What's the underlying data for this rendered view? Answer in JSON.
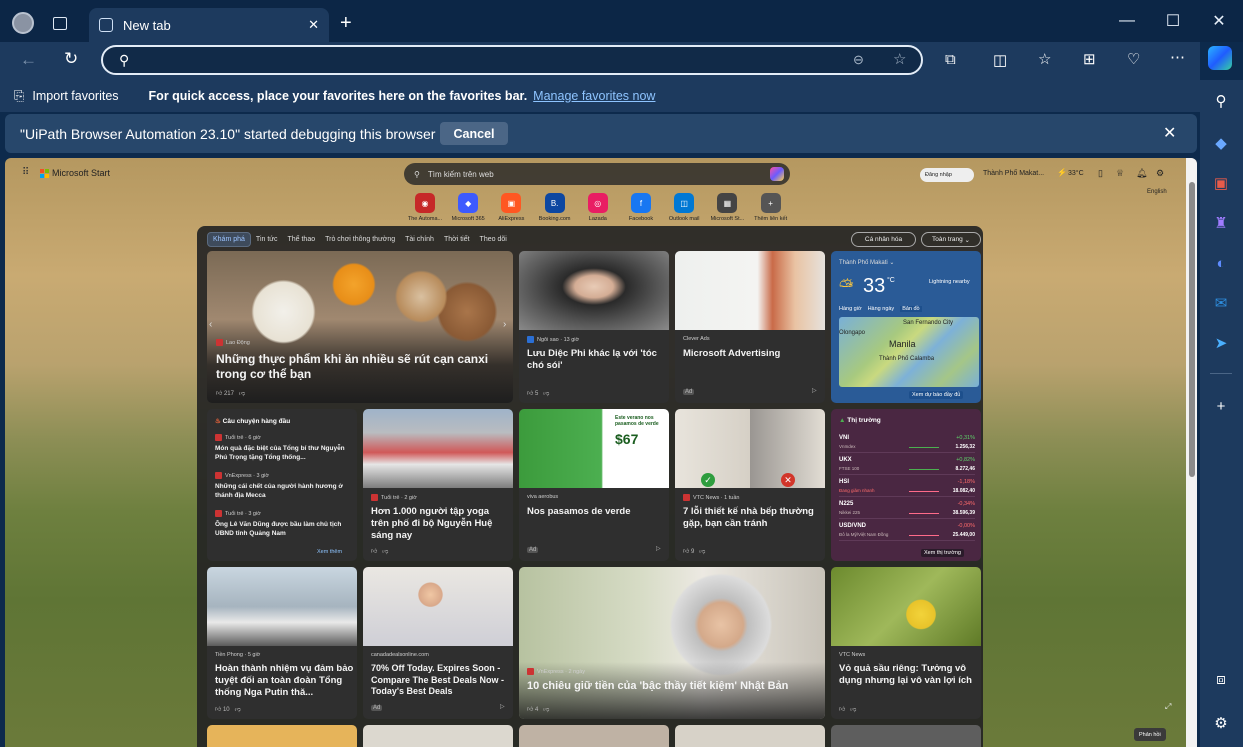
{
  "browser": {
    "tab_title": "New tab",
    "address_value": ""
  },
  "favorites": {
    "import_label": "Import favorites",
    "prompt": "For quick access, place your favorites here on the favorites bar.",
    "manage_link": "Manage favorites now"
  },
  "infobar": {
    "message": "\"UiPath Browser Automation 23.10\" started debugging this browser",
    "cancel_label": "Cancel"
  },
  "msn": {
    "brand": "Microsoft Start",
    "search_placeholder": "Tìm kiếm trên web",
    "signin": "Đăng nhập",
    "location": "Thành Phố Makat...",
    "temp": "33°C",
    "language": "English",
    "shortcuts": [
      "The Automa...",
      "Microsoft 365",
      "AliExpress",
      "Booking.com",
      "Lazada",
      "Facebook",
      "Outlook mail",
      "Microsoft St...",
      "Thêm liên kết"
    ],
    "nav": [
      "Khám phá",
      "Tin tức",
      "Thể thao",
      "Trò chơi thông thường",
      "Tài chính",
      "Thời tiết",
      "Theo dõi"
    ],
    "personalize": "Cá nhân hóa",
    "layout": "Toàn trang",
    "hero": {
      "source": "Lao Động",
      "title": "Những thực phẩm khi ăn nhiều sẽ rút cạn canxi trong cơ thể bạn",
      "likes": "217"
    },
    "card2": {
      "source": "Ngôi sao · 13 giờ",
      "title": "Lưu Diệc Phi khác lạ với 'tóc chó sói'",
      "likes": "5"
    },
    "card3": {
      "source": "Clever Ads",
      "title": "Microsoft Advertising",
      "ad": "Ad"
    },
    "weather": {
      "place": "Thành Phố Makati",
      "temp": "33",
      "unit": "°C",
      "alert": "Lightning nearby",
      "tabs": [
        "Hàng giờ",
        "Hàng ngày",
        "Bản đồ"
      ],
      "map_labels": [
        "San Fernando City",
        "Olongapo",
        "Manila",
        "Thành Phố Calamba"
      ],
      "link": "Xem dự báo đầy đủ"
    },
    "top_stories": {
      "header": "Câu chuyện hàng đầu",
      "items": [
        {
          "source": "Tuổi trẻ · 6 giờ",
          "title": "Món quà đặc biệt của Tổng bí thư Nguyễn Phú Trọng tặng Tổng thống..."
        },
        {
          "source": "VnExpress · 3 giờ",
          "title": "Những cái chết của người hành hương ở thánh địa Mecca"
        },
        {
          "source": "Tuổi trẻ · 3 giờ",
          "title": "Ông Lê Văn Dũng được bầu làm chủ tịch UBND tỉnh Quảng Nam"
        }
      ],
      "more": "Xem thêm"
    },
    "yoga": {
      "source": "Tuổi trẻ · 2 giờ",
      "title": "Hơn 1.000 người tập yoga trên phố đi bộ Nguyễn Huệ sáng nay"
    },
    "viva": {
      "source": "viva aerobus",
      "title": "Nos pasamos de verde",
      "ad": "Ad",
      "promo_title": "Este verano nos pasamos de verde",
      "promo_price": "$67"
    },
    "kitchen": {
      "source": "VTC News · 1 tuần",
      "title": "7 lỗi thiết kế nhà bếp thường gặp, bạn cần tránh",
      "likes": "9"
    },
    "market": {
      "header": "Thị trường",
      "rows": [
        {
          "sym": "VNI",
          "name": "VnIndex",
          "chg": "+0,31%",
          "val": "1.256,32",
          "up": true
        },
        {
          "sym": "UKX",
          "name": "FTSE 100",
          "chg": "+0,82%",
          "val": "8.272,46",
          "up": true
        },
        {
          "sym": "HSI",
          "name": "Đang giảm nhanh",
          "chg": "-1,18%",
          "val": "18.082,40",
          "up": false
        },
        {
          "sym": "N225",
          "name": "Nikkei 225",
          "chg": "-0,34%",
          "val": "38.596,39",
          "up": false
        },
        {
          "sym": "USD/VND",
          "name": "Đô la Mỹ/Việt Nam Đồng",
          "chg": "-0,00%",
          "val": "25.449,00",
          "up": false
        }
      ],
      "link": "Xem thị trường"
    },
    "police": {
      "source": "Tiền Phong · 5 giờ",
      "title": "Hoàn thành nhiệm vụ đảm bảo tuyệt đối an toàn đoàn Tổng thống Nga Putin thă...",
      "likes": "10"
    },
    "deals": {
      "source": "canadadealsonline.com",
      "title": "70% Off Today. Expires Soon - Compare The Best Deals Now - Today's Best Deals",
      "ad": "Ad"
    },
    "grandma": {
      "source": "VnExpress · 2 ngày",
      "title": "10 chiêu giữ tiền của 'bậc thầy tiết kiệm' Nhật Bản",
      "likes": "4"
    },
    "durian": {
      "source": "VTC News",
      "title": "Vỏ quả sầu riêng: Tưởng vô dụng nhưng lại vô vàn lợi ích"
    },
    "feedback": "Phản hồi"
  }
}
